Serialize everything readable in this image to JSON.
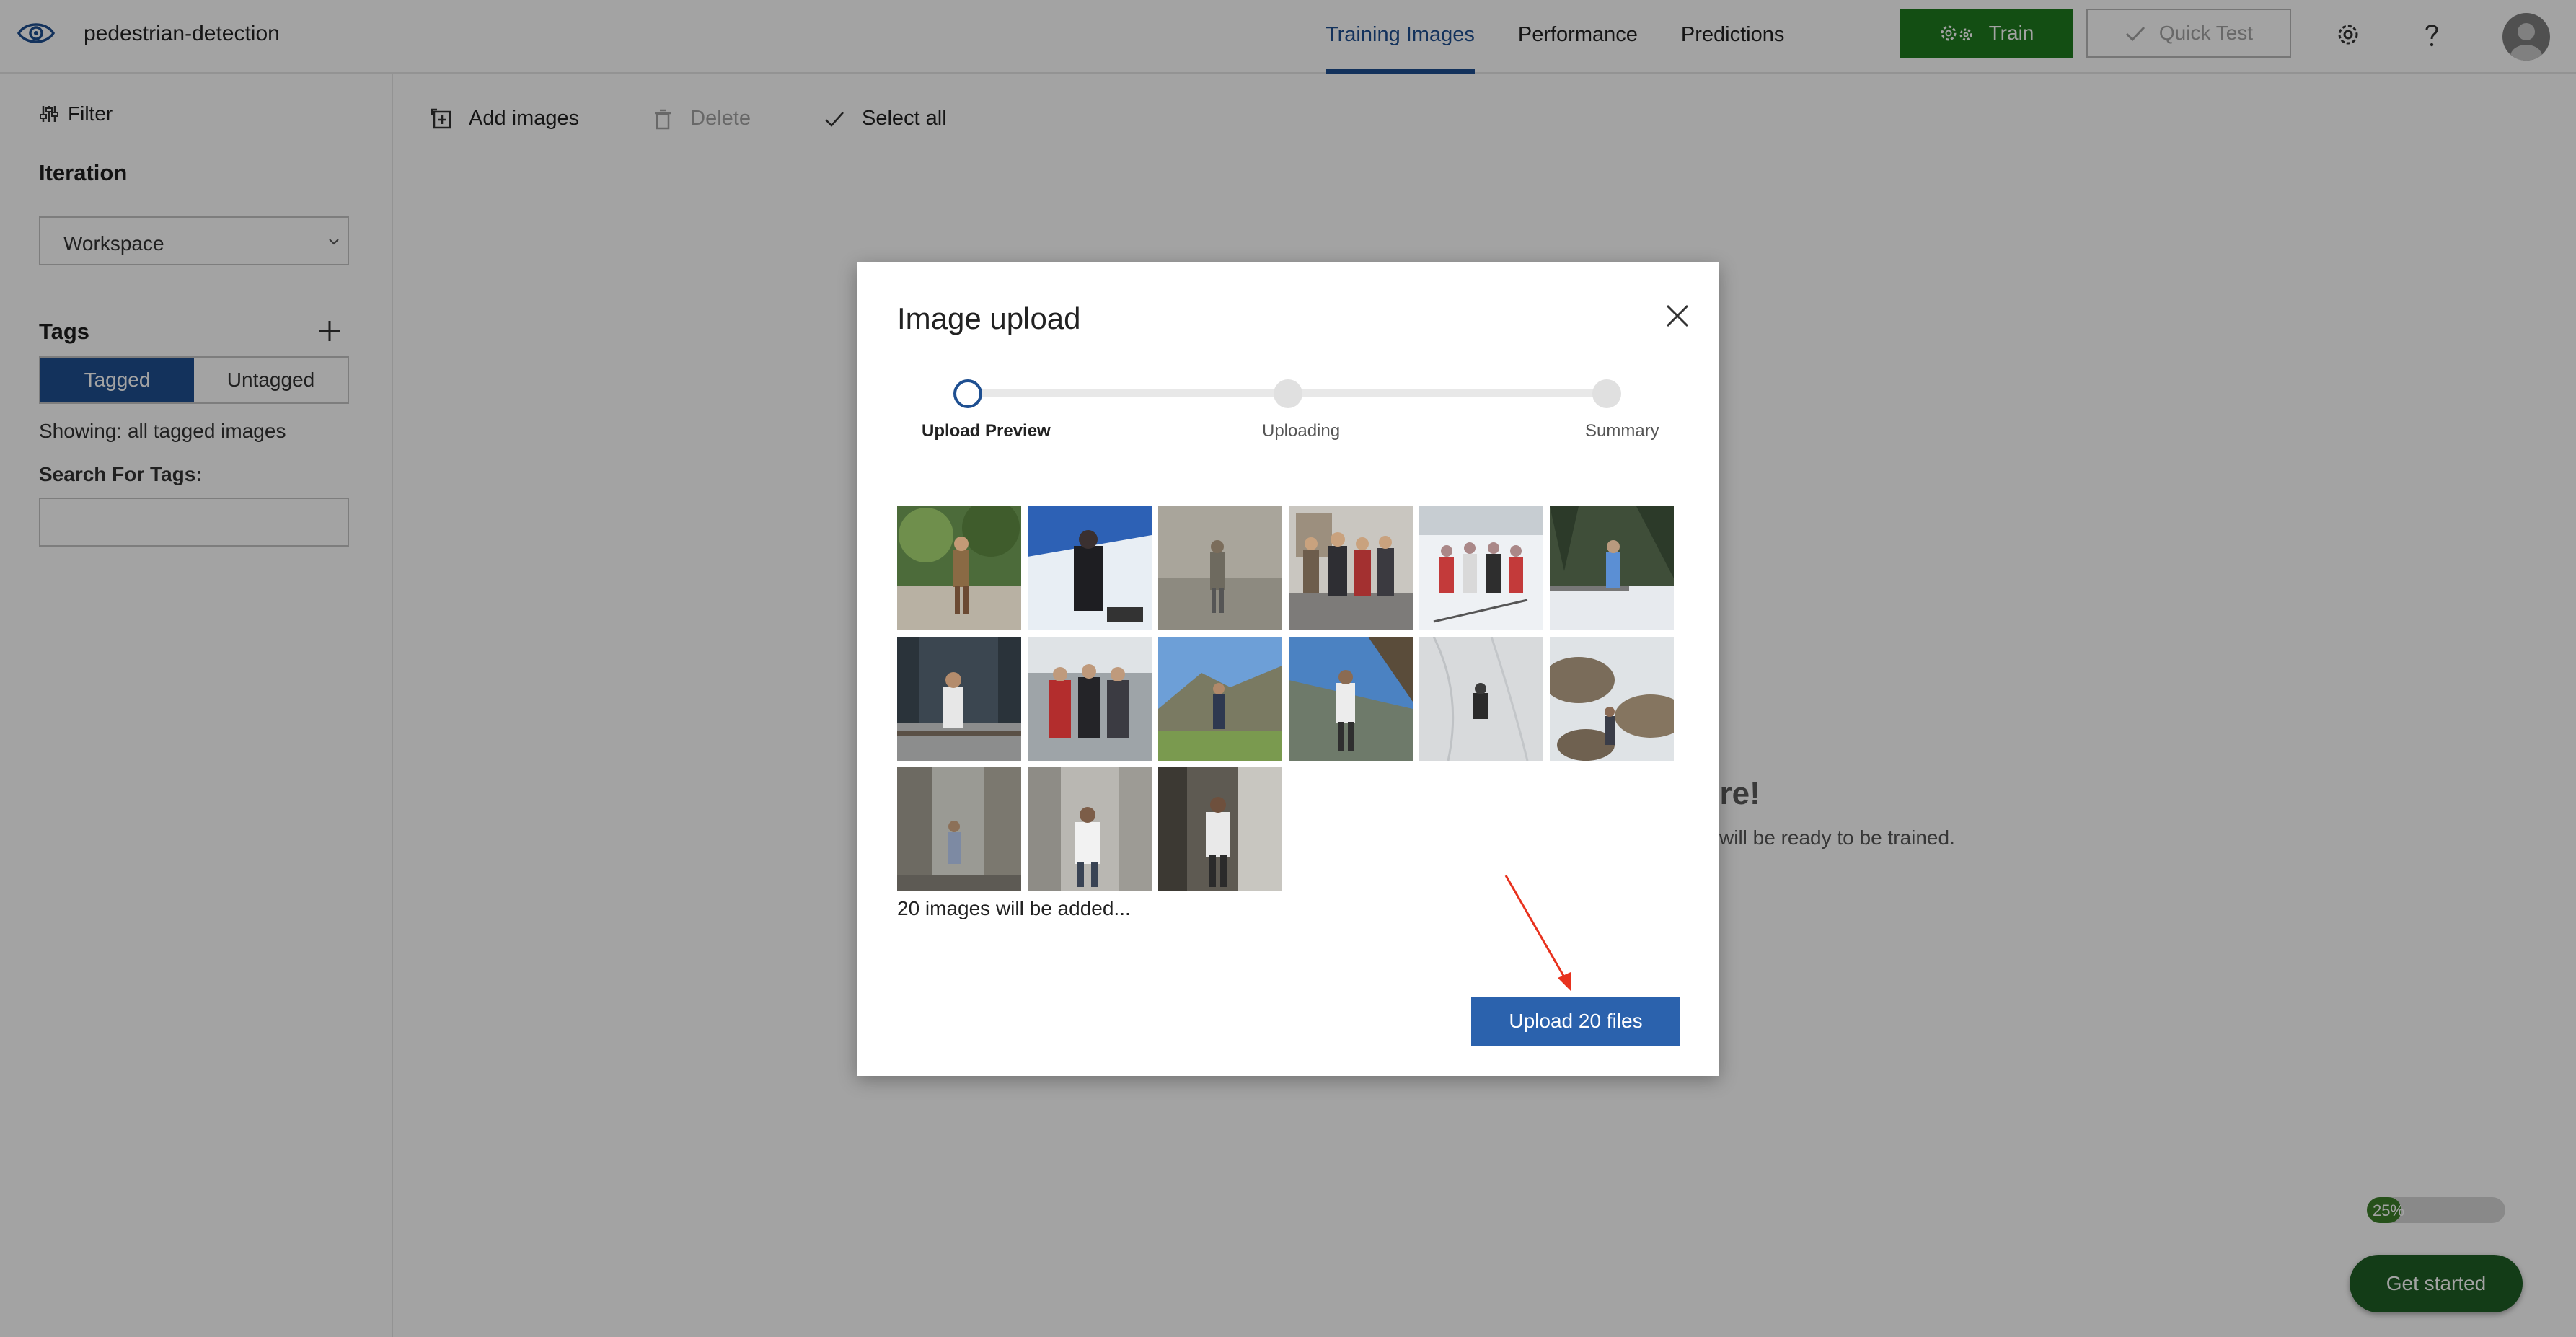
{
  "header": {
    "project_name": "pedestrian-detection",
    "tabs": [
      {
        "label": "Training Images",
        "active": true
      },
      {
        "label": "Performance",
        "active": false
      },
      {
        "label": "Predictions",
        "active": false
      }
    ],
    "train_label": "Train",
    "quick_test_label": "Quick Test",
    "icons": [
      "eye-icon",
      "gear-icon",
      "help-icon",
      "avatar"
    ]
  },
  "sidebar": {
    "filter_label": "Filter",
    "iteration_label": "Iteration",
    "iteration_value": "Workspace",
    "tags_label": "Tags",
    "toggle": [
      "Tagged",
      "Untagged"
    ],
    "toggle_selected": "Tagged",
    "showing_text": "Showing: all tagged images",
    "search_label": "Search For Tags:",
    "search_value": ""
  },
  "toolbar": {
    "add_images": "Add images",
    "delete": "Delete",
    "select_all": "Select all"
  },
  "background": {
    "empty_title_fragment": "ere!",
    "empty_subtitle_fragment": "will be ready to be trained."
  },
  "onboarding": {
    "progress_percent": 25,
    "progress_label": "25%",
    "get_started_label": "Get started"
  },
  "modal": {
    "title": "Image upload",
    "steps": [
      {
        "label": "Upload Preview",
        "current": true
      },
      {
        "label": "Uploading",
        "current": false
      },
      {
        "label": "Summary",
        "current": false
      }
    ],
    "thumbnail_count": 15,
    "images_text": "20 images will be added...",
    "upload_button": "Upload 20 files"
  },
  "colors": {
    "accent_blue": "#1e4f91",
    "button_blue": "#2b62ad",
    "train_green": "#1f7a1f",
    "get_started_green": "#1f5e25",
    "annotation_red": "#e8321e"
  }
}
